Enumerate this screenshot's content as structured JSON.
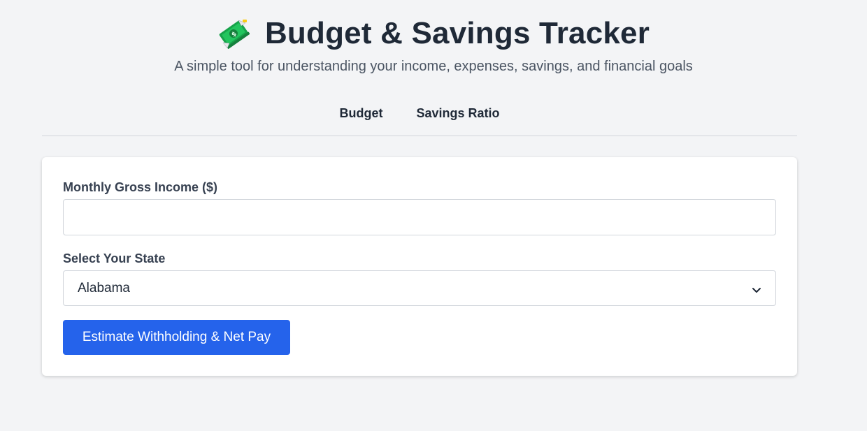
{
  "header": {
    "title": "Budget & Savings Tracker",
    "title_icon": "money-bill-wings-icon",
    "subtitle": "A simple tool for understanding your income, expenses, savings, and financial goals"
  },
  "tabs": [
    {
      "label": "Budget"
    },
    {
      "label": "Savings Ratio"
    }
  ],
  "form": {
    "income_label": "Monthly Gross Income ($)",
    "income_value": "",
    "income_placeholder": "",
    "state_label": "Select Your State",
    "state_selected": "Alabama",
    "submit_label": "Estimate Withholding & Net Pay"
  },
  "colors": {
    "background": "#f3f4f6",
    "card": "#ffffff",
    "primary_button": "#2563eb",
    "text_dark": "#1f2937",
    "text_muted": "#4b5563",
    "border": "#d1d5db"
  }
}
